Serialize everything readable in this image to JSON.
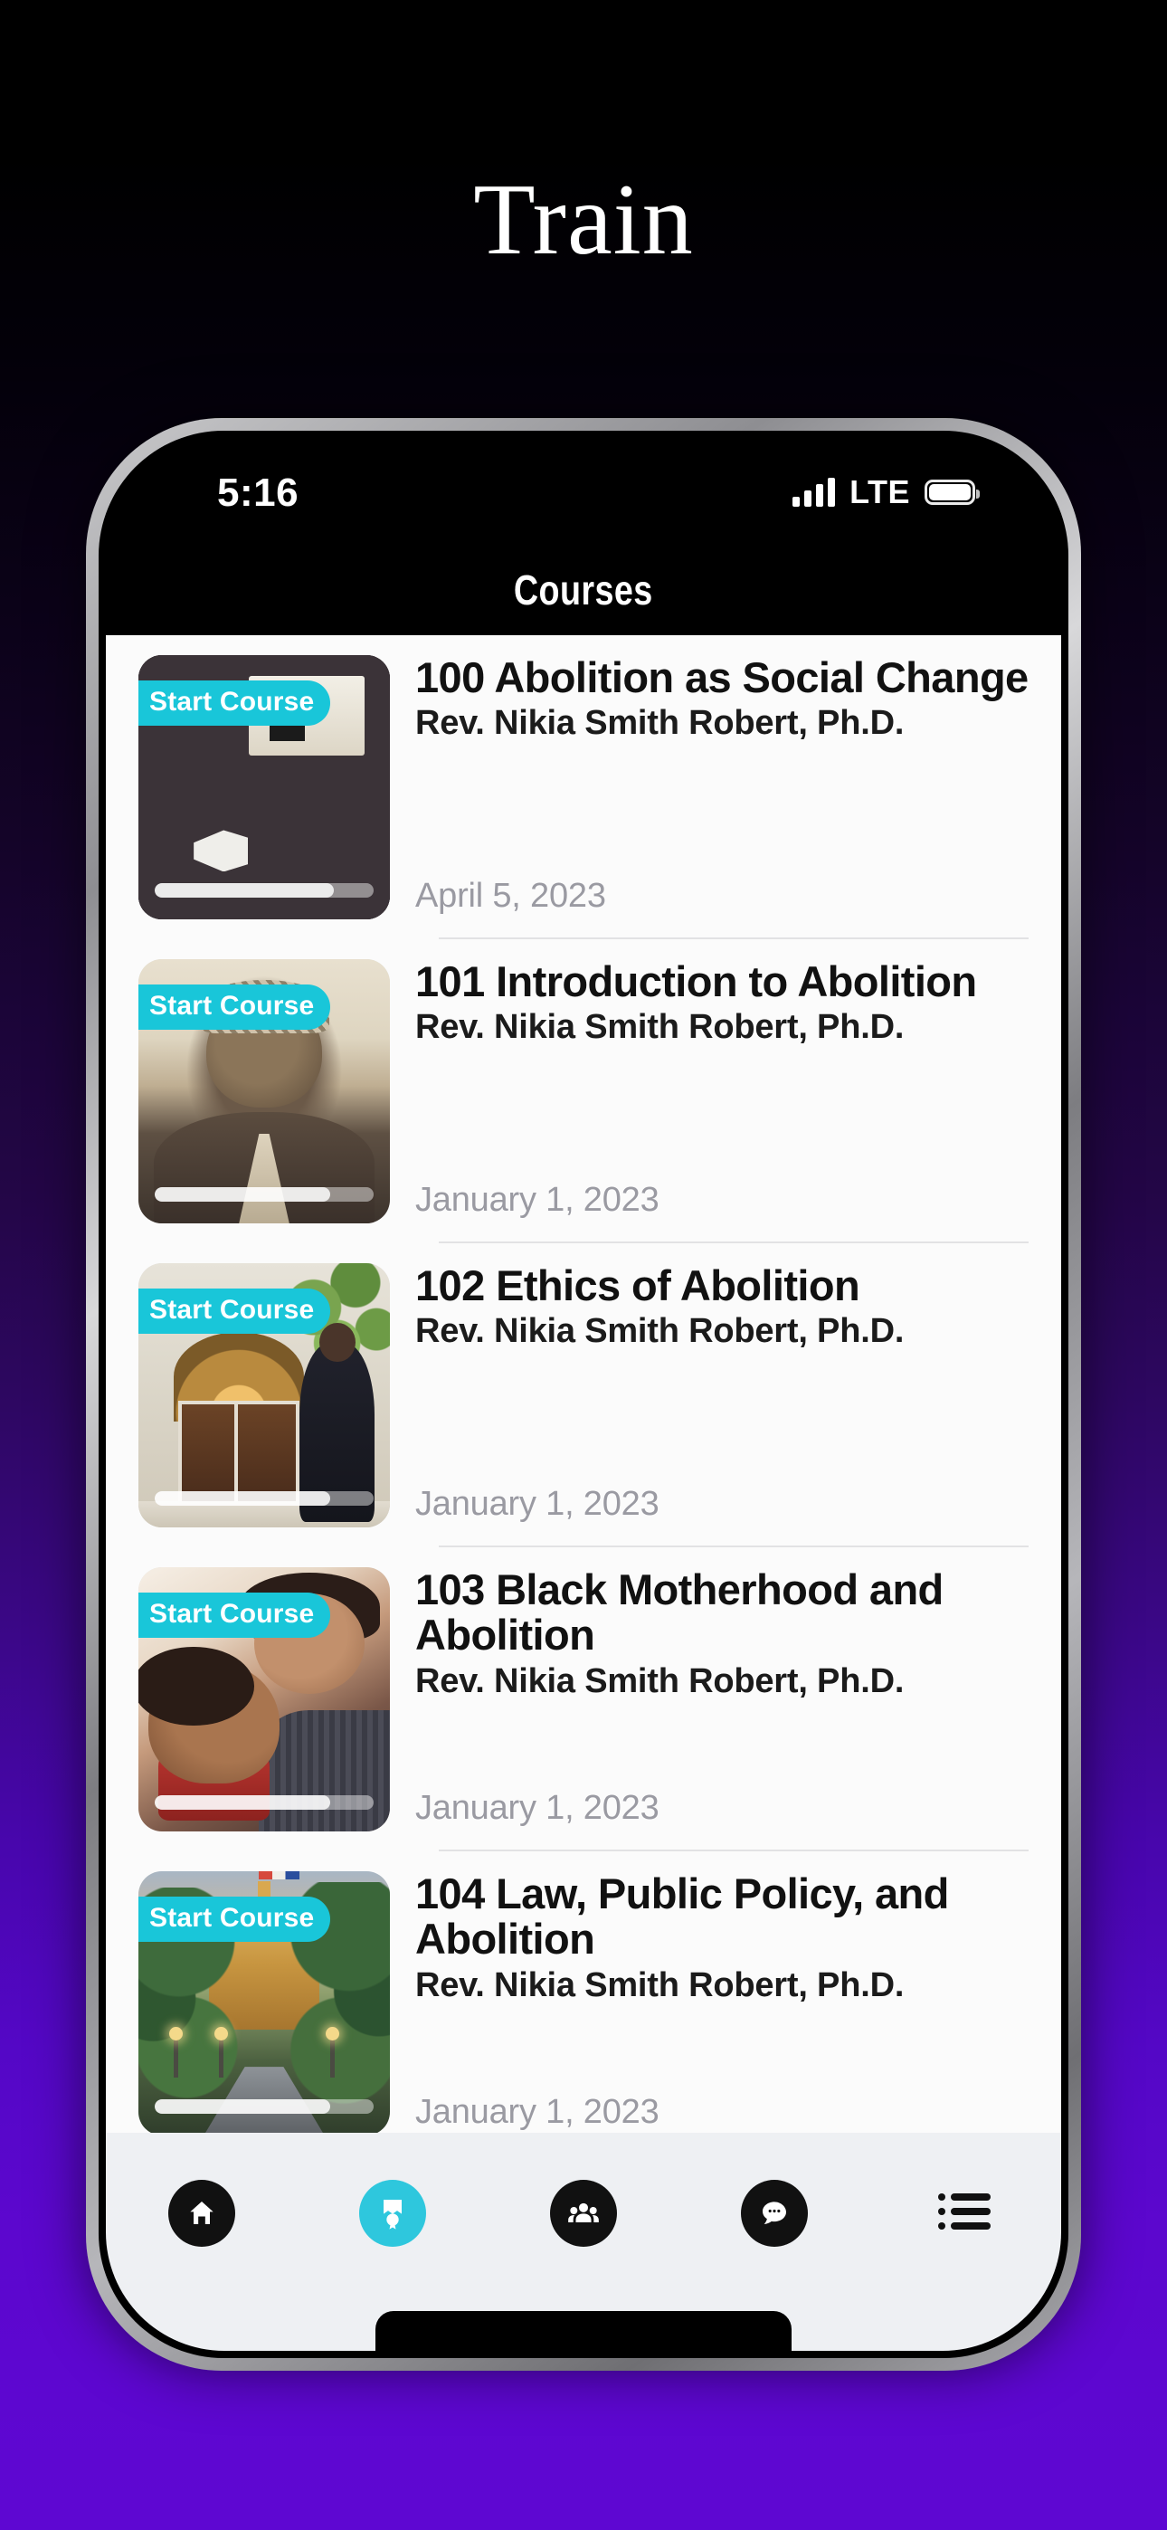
{
  "hero": {
    "title": "Train"
  },
  "status_bar": {
    "time": "5:16",
    "network": "LTE",
    "signal_icon": "cellular-bars-icon",
    "battery_icon": "battery-full-icon"
  },
  "nav": {
    "title": "Courses"
  },
  "colors": {
    "accent_cyan": "#19c6d9",
    "tab_active": "#2ec7dd",
    "backdrop_purple": "#5c07ce",
    "list_background": "#fbfbfb",
    "tab_bar_background": "#eef0f3",
    "date_text": "#9a9aa2"
  },
  "courses": [
    {
      "badge": "Start Course",
      "title": "100 Abolition as Social Change",
      "author": "Rev. Nikia Smith Robert, Ph.D.",
      "date": "April 5, 2023",
      "progress_percent": 82,
      "thumbnail": "protest-march-photo"
    },
    {
      "badge": "Start Course",
      "title": "101 Introduction to Abolition",
      "author": "Rev. Nikia Smith Robert, Ph.D.",
      "date": "January 1, 2023",
      "progress_percent": 80,
      "thumbnail": "harriet-tubman-portrait-photo"
    },
    {
      "badge": "Start Course",
      "title": "102 Ethics of Abolition",
      "author": "Rev. Nikia Smith Robert, Ph.D.",
      "date": "January 1, 2023",
      "progress_percent": 80,
      "thumbnail": "pearsons-hall-entrance-photo"
    },
    {
      "badge": "Start Course",
      "title": "103 Black Motherhood and Abolition",
      "author": "Rev. Nikia Smith Robert, Ph.D.",
      "date": "January 1, 2023",
      "progress_percent": 80,
      "thumbnail": "mother-and-child-photo"
    },
    {
      "badge": "Start Course",
      "title": "104 Law, Public Policy, and Abolition",
      "author": "Rev. Nikia Smith Robert, Ph.D.",
      "date": "January 1, 2023",
      "progress_percent": 80,
      "thumbnail": "capitol-building-photo"
    }
  ],
  "tab_bar": {
    "items": [
      {
        "icon": "home-icon",
        "active": false
      },
      {
        "icon": "courses-icon",
        "active": true
      },
      {
        "icon": "community-icon",
        "active": false
      },
      {
        "icon": "chat-icon",
        "active": false
      },
      {
        "icon": "list-menu-icon",
        "active": false
      }
    ]
  }
}
